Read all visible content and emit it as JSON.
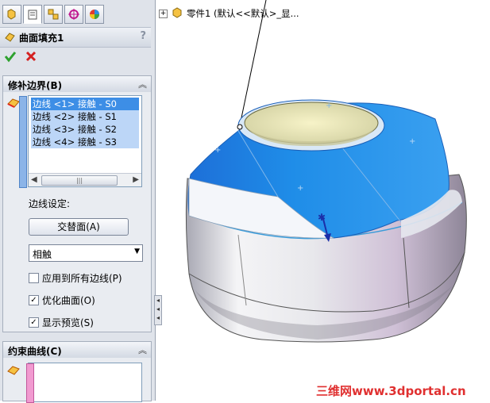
{
  "feature": {
    "title": "曲面填充1",
    "help": "?"
  },
  "tabs": [
    {
      "icon": "feature-manager-icon"
    },
    {
      "icon": "property-manager-icon"
    },
    {
      "icon": "configuration-manager-icon"
    },
    {
      "icon": "dimxpert-manager-icon"
    },
    {
      "icon": "display-manager-icon"
    }
  ],
  "patch_boundary": {
    "title": "修补边界(B)",
    "edges": [
      "边线 <1> 接触 - S0",
      "边线 <2> 接触 - S1",
      "边线 <3> 接触 - S2",
      "边线 <4> 接触 - S3"
    ],
    "selected_index": 0,
    "edge_settings_label": "边线设定:",
    "alternate_face_button": "交替面(A)",
    "condition_value": "相触",
    "apply_all_label": "应用到所有边线(P)",
    "apply_all_checked": false,
    "optimize_label": "优化曲面(O)",
    "optimize_checked": true,
    "preview_label": "显示预览(S)",
    "preview_checked": true
  },
  "constraint_curves": {
    "title": "约束曲线(C)"
  },
  "tree": {
    "part_label": "零件1 (默认<<默认>_显..."
  },
  "watermark": "三维网www.3dportal.cn",
  "colors": {
    "selection_blue": "#3d8ee6",
    "surface_blue": "#1f8de8",
    "ok_green": "#2ea12e",
    "cancel_red": "#d42020"
  }
}
